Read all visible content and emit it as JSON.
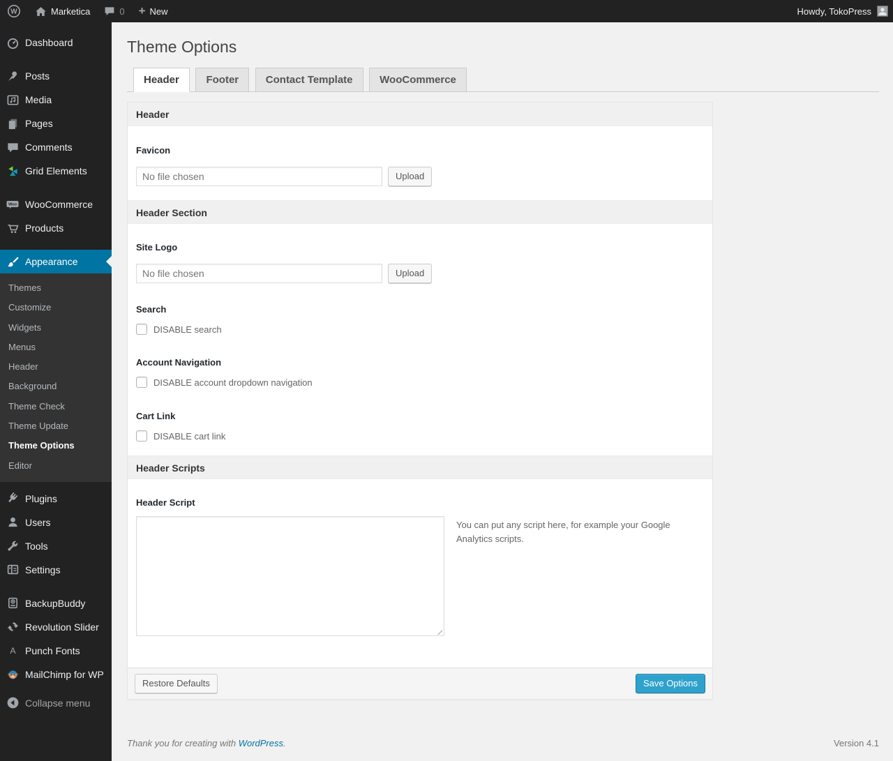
{
  "admin_bar": {
    "wordpress_glyph": "W",
    "site_name": "Marketica",
    "comment_count": "0",
    "new_label": "New",
    "plus_glyph": "+",
    "howdy": "Howdy, TokoPress"
  },
  "sidebar": {
    "items": [
      {
        "label": "Dashboard"
      },
      {
        "label": "Posts"
      },
      {
        "label": "Media"
      },
      {
        "label": "Pages"
      },
      {
        "label": "Comments"
      },
      {
        "label": "Grid Elements"
      },
      {
        "label": "WooCommerce"
      },
      {
        "label": "Products"
      },
      {
        "label": "Appearance"
      },
      {
        "label": "Plugins"
      },
      {
        "label": "Users"
      },
      {
        "label": "Tools"
      },
      {
        "label": "Settings"
      },
      {
        "label": "BackupBuddy"
      },
      {
        "label": "Revolution Slider"
      },
      {
        "label": "Punch Fonts"
      },
      {
        "label": "MailChimp for WP"
      }
    ],
    "submenu": {
      "items": [
        {
          "label": "Themes"
        },
        {
          "label": "Customize"
        },
        {
          "label": "Widgets"
        },
        {
          "label": "Menus"
        },
        {
          "label": "Header"
        },
        {
          "label": "Background"
        },
        {
          "label": "Theme Check"
        },
        {
          "label": "Theme Update"
        },
        {
          "label": "Theme Options"
        },
        {
          "label": "Editor"
        }
      ],
      "current": "Theme Options"
    },
    "collapse_label": "Collapse menu",
    "woo_badge": "Woo",
    "punch_fonts_glyph": "A"
  },
  "page": {
    "title": "Theme Options",
    "tabs": [
      {
        "label": "Header"
      },
      {
        "label": "Footer"
      },
      {
        "label": "Contact Template"
      },
      {
        "label": "WooCommerce"
      }
    ],
    "panel": {
      "section_header_1": "Header",
      "favicon_label": "Favicon",
      "file_placeholder": "No file chosen",
      "upload_label": "Upload",
      "section_header_2": "Header Section",
      "site_logo_label": "Site Logo",
      "search_label": "Search",
      "disable_search_label": "DISABLE search",
      "account_nav_label": "Account Navigation",
      "disable_account_label": "DISABLE account dropdown navigation",
      "cart_link_label": "Cart Link",
      "disable_cart_label": "DISABLE cart link",
      "section_header_3": "Header Scripts",
      "header_script_label": "Header Script",
      "script_help": "You can put any script here, for example your Google Analytics scripts.",
      "restore_label": "Restore Defaults",
      "save_label": "Save Options"
    }
  },
  "footer": {
    "thanks_prefix": "Thank you for creating with ",
    "wordpress_link": "WordPress",
    "suffix": ".",
    "version": "Version 4.1"
  },
  "colors": {
    "accent_blue": "#0074a2",
    "primary_button": "#2ea2cc",
    "menu_bg": "#222222",
    "submenu_bg": "#333333",
    "page_bg": "#f1f1f1",
    "tab_inactive_bg": "#e4e4e4"
  }
}
